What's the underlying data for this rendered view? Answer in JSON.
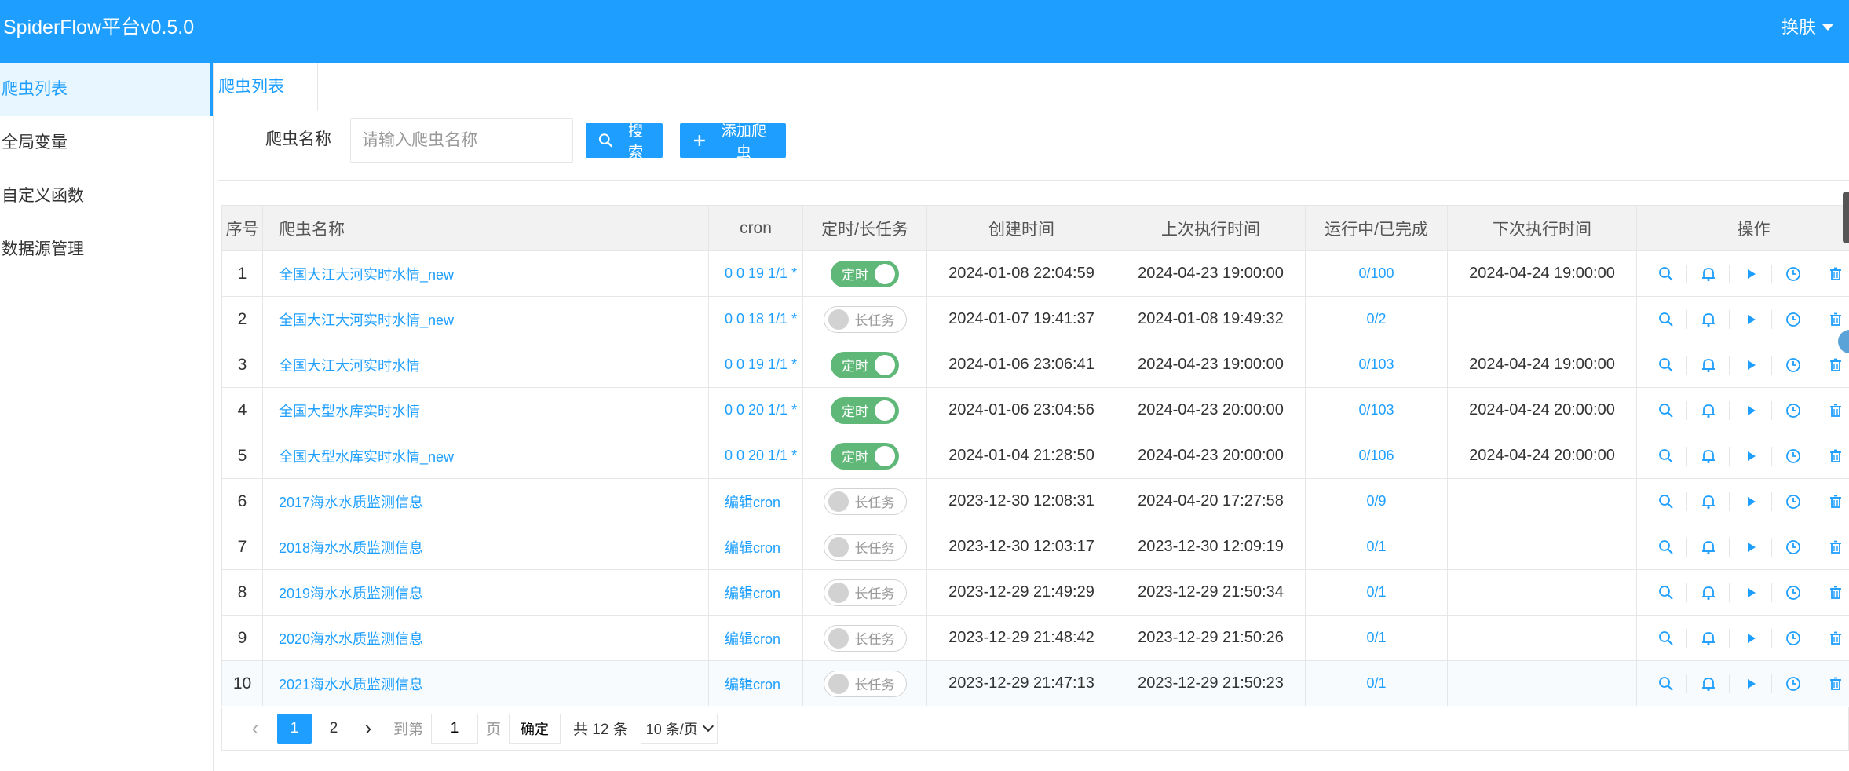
{
  "header": {
    "logo": "SpiderFlow平台v0.5.0",
    "skin_label": "换肤"
  },
  "sidebar": {
    "items": [
      {
        "label": "爬虫列表",
        "active": true
      },
      {
        "label": "全局变量"
      },
      {
        "label": "自定义函数"
      },
      {
        "label": "数据源管理"
      }
    ]
  },
  "tabs": [
    {
      "label": "爬虫列表"
    }
  ],
  "search": {
    "label": "爬虫名称",
    "placeholder": "请输入爬虫名称",
    "search_button": "搜索",
    "add_button": "添加爬虫"
  },
  "table": {
    "columns": [
      "序号",
      "爬虫名称",
      "cron",
      "定时/长任务",
      "创建时间",
      "上次执行时间",
      "运行中/已完成",
      "下次执行时间",
      "操作"
    ],
    "rows": [
      {
        "idx": "1",
        "name": "全国大江大河实时水情_new",
        "cron": "0 0 19 1/1 *",
        "switch_on": true,
        "switch_label": "定时",
        "created": "2024-01-08 22:04:59",
        "last": "2024-04-23 19:00:00",
        "status": "0/100",
        "next": "2024-04-24 19:00:00"
      },
      {
        "idx": "2",
        "name": "全国大江大河实时水情_new",
        "cron": "0 0 18 1/1 *",
        "switch_on": false,
        "switch_label": "长任务",
        "created": "2024-01-07 19:41:37",
        "last": "2024-01-08 19:49:32",
        "status": "0/2",
        "next": ""
      },
      {
        "idx": "3",
        "name": "全国大江大河实时水情",
        "cron": "0 0 19 1/1 *",
        "switch_on": true,
        "switch_label": "定时",
        "created": "2024-01-06 23:06:41",
        "last": "2024-04-23 19:00:00",
        "status": "0/103",
        "next": "2024-04-24 19:00:00"
      },
      {
        "idx": "4",
        "name": "全国大型水库实时水情",
        "cron": "0 0 20 1/1 *",
        "switch_on": true,
        "switch_label": "定时",
        "created": "2024-01-06 23:04:56",
        "last": "2024-04-23 20:00:00",
        "status": "0/103",
        "next": "2024-04-24 20:00:00"
      },
      {
        "idx": "5",
        "name": "全国大型水库实时水情_new",
        "cron": "0 0 20 1/1 *",
        "switch_on": true,
        "switch_label": "定时",
        "created": "2024-01-04 21:28:50",
        "last": "2024-04-23 20:00:00",
        "status": "0/106",
        "next": "2024-04-24 20:00:00"
      },
      {
        "idx": "6",
        "name": "2017海水水质监测信息",
        "cron": "编辑cron",
        "switch_on": false,
        "switch_label": "长任务",
        "created": "2023-12-30 12:08:31",
        "last": "2024-04-20 17:27:58",
        "status": "0/9",
        "next": ""
      },
      {
        "idx": "7",
        "name": "2018海水水质监测信息",
        "cron": "编辑cron",
        "switch_on": false,
        "switch_label": "长任务",
        "created": "2023-12-30 12:03:17",
        "last": "2023-12-30 12:09:19",
        "status": "0/1",
        "next": ""
      },
      {
        "idx": "8",
        "name": "2019海水水质监测信息",
        "cron": "编辑cron",
        "switch_on": false,
        "switch_label": "长任务",
        "created": "2023-12-29 21:49:29",
        "last": "2023-12-29 21:50:34",
        "status": "0/1",
        "next": ""
      },
      {
        "idx": "9",
        "name": "2020海水水质监测信息",
        "cron": "编辑cron",
        "switch_on": false,
        "switch_label": "长任务",
        "created": "2023-12-29 21:48:42",
        "last": "2023-12-29 21:50:26",
        "status": "0/1",
        "next": ""
      },
      {
        "idx": "10",
        "name": "2021海水水质监测信息",
        "cron": "编辑cron",
        "switch_on": false,
        "switch_label": "长任务",
        "created": "2023-12-29 21:47:13",
        "last": "2023-12-29 21:50:23",
        "status": "0/1",
        "next": ""
      }
    ],
    "row_actions": [
      "search-icon",
      "bell-icon",
      "play-icon",
      "clock-icon",
      "trash-icon"
    ]
  },
  "pagination": {
    "pages": [
      "1",
      "2"
    ],
    "current": "1",
    "goto_label": "到第",
    "goto_value": "1",
    "page_unit": "页",
    "confirm": "确定",
    "total": "共 12 条",
    "page_size": "10 条/页"
  },
  "colors": {
    "primary": "#1E9FFF",
    "switch_on": "#5FB878"
  }
}
